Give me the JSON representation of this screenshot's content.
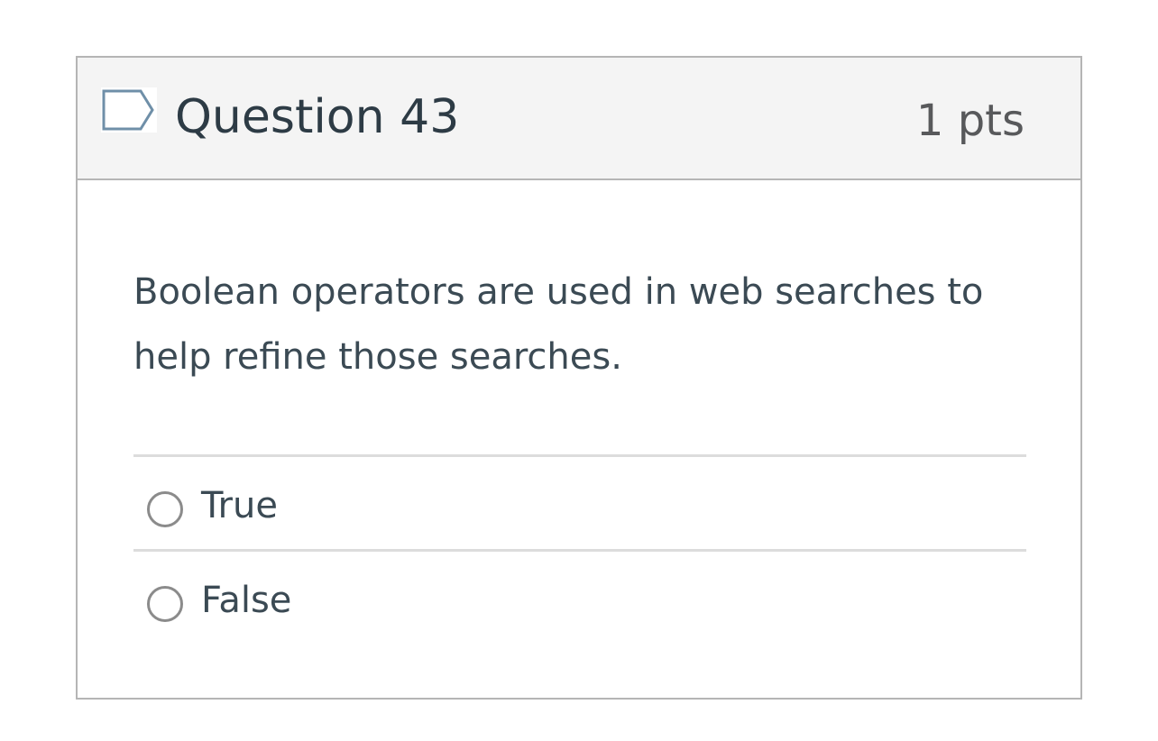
{
  "question": {
    "title": "Question 43",
    "points": "1 pts",
    "flag_icon": "flag-bookmark-icon",
    "text": "Boolean operators are used in web searches to help refine those searches.",
    "answers": [
      {
        "label": "True",
        "selected": false
      },
      {
        "label": "False",
        "selected": false
      }
    ]
  },
  "colors": {
    "header_bg": "#f4f4f4",
    "border": "#b5b5b5",
    "title_text": "#2d3b45",
    "body_text": "#3b4a54",
    "flag_stroke": "#6f8fa8",
    "radio_border": "#8b8b8b"
  }
}
